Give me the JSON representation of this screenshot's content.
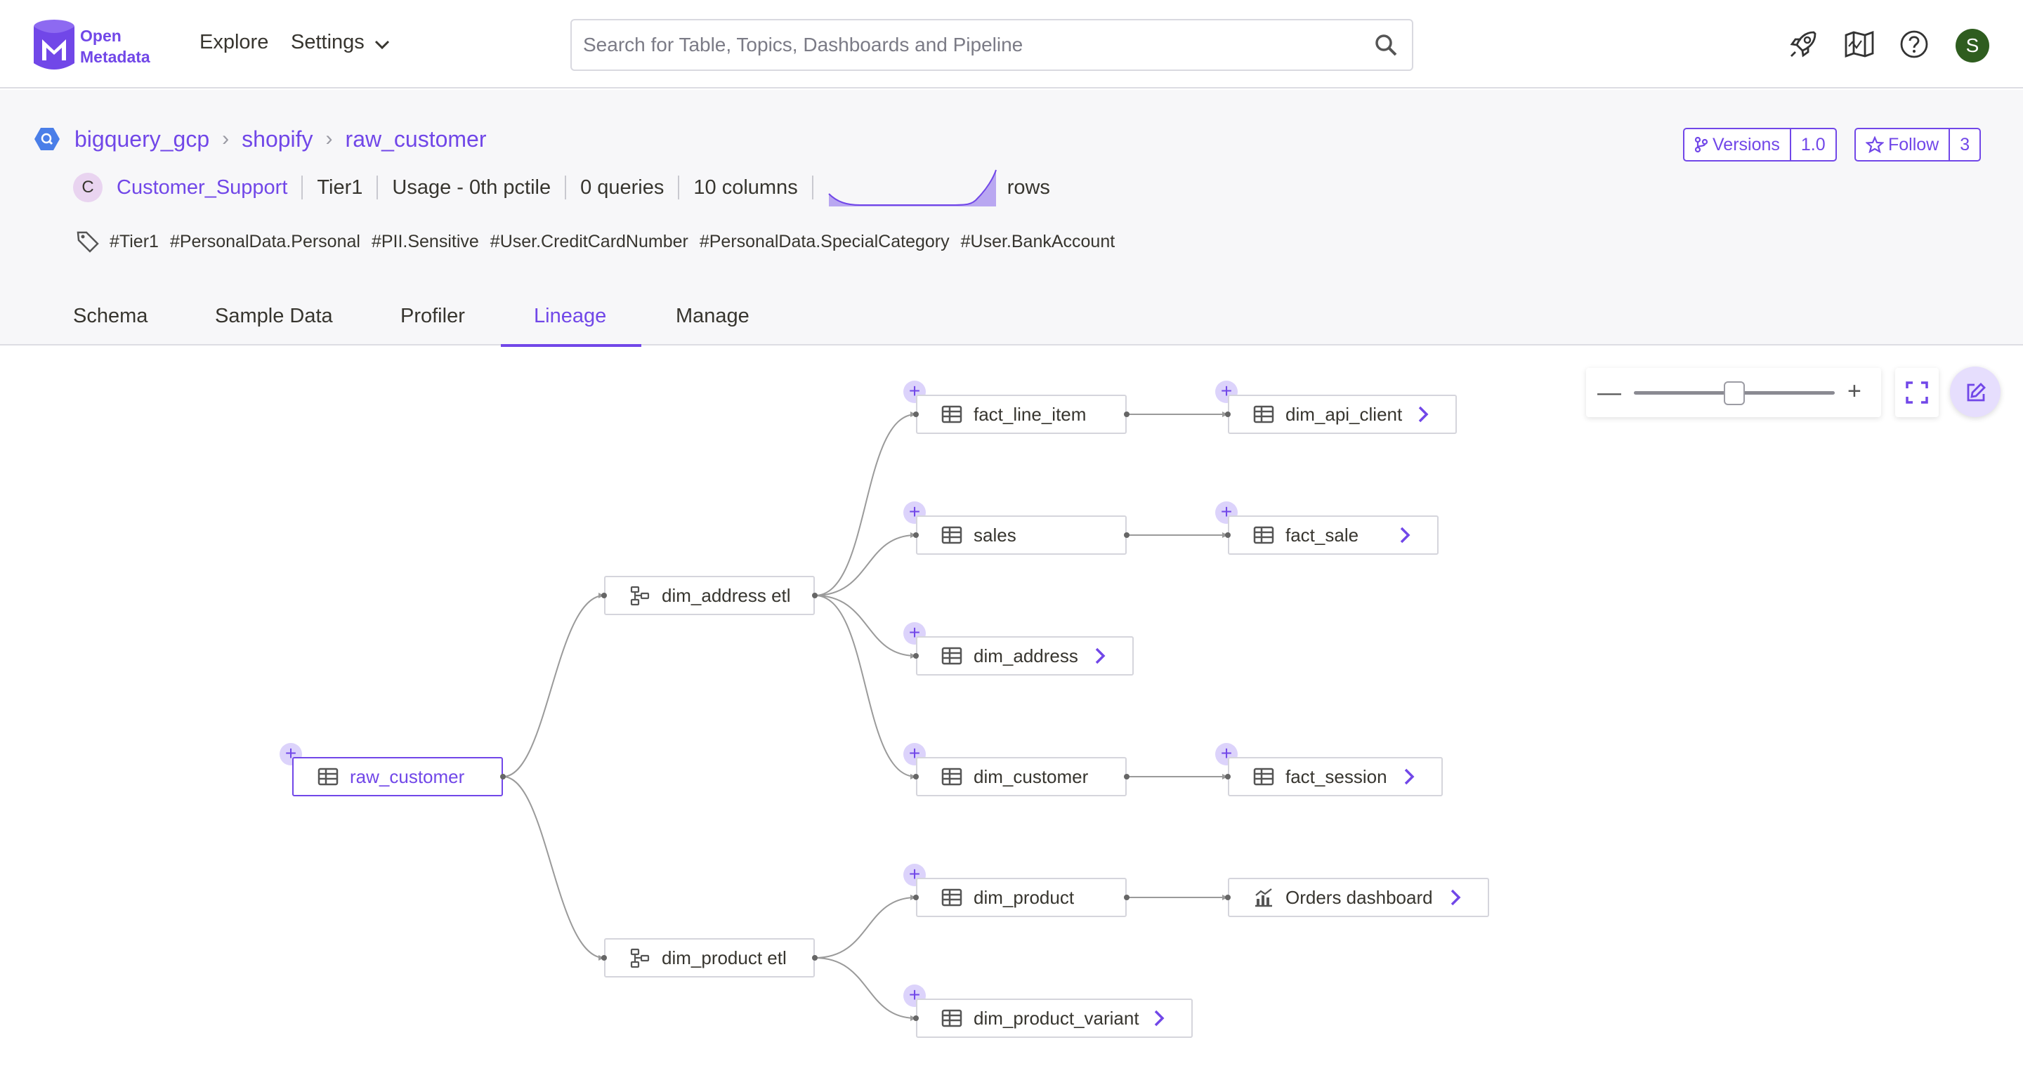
{
  "nav": {
    "logo_line1": "Open",
    "logo_line2": "Metadata",
    "explore": "Explore",
    "settings": "Settings",
    "search_placeholder": "Search for Table, Topics, Dashboards and Pipeline",
    "avatar_initial": "S",
    "icons": [
      "rocket-icon",
      "map-icon",
      "help-icon"
    ]
  },
  "entity": {
    "breadcrumb": [
      "bigquery_gcp",
      "shopify",
      "raw_customer"
    ],
    "owner_initial": "C",
    "owner": "Customer_Support",
    "tier": "Tier1",
    "usage": "Usage - 0th pctile",
    "queries": "0 queries",
    "columns": "10 columns",
    "rows_label": "rows",
    "tags": [
      "#Tier1",
      "#PersonalData.Personal",
      "#PII.Sensitive",
      "#User.CreditCardNumber",
      "#PersonalData.SpecialCategory",
      "#User.BankAccount"
    ],
    "versions_label": "Versions",
    "version": "1.0",
    "follow_label": "Follow",
    "followers": "3"
  },
  "tabs": [
    "Schema",
    "Sample Data",
    "Profiler",
    "Lineage",
    "Manage"
  ],
  "active_tab": "Lineage",
  "lineage": {
    "nodes": {
      "raw_customer": "raw_customer",
      "dim_address_etl": "dim_address etl",
      "dim_product_etl": "dim_product etl",
      "fact_line_item": "fact_line_item",
      "sales": "sales",
      "dim_address": "dim_address",
      "dim_customer": "dim_customer",
      "dim_product": "dim_product",
      "dim_product_variant": "dim_product_variant",
      "dim_api_client": "dim_api_client",
      "fact_sale": "fact_sale",
      "fact_session": "fact_session",
      "orders_dashboard": "Orders dashboard"
    },
    "zoom_level": 0.5
  },
  "colors": {
    "accent": "#7147e8",
    "plus_bg": "#dcd3fb"
  }
}
